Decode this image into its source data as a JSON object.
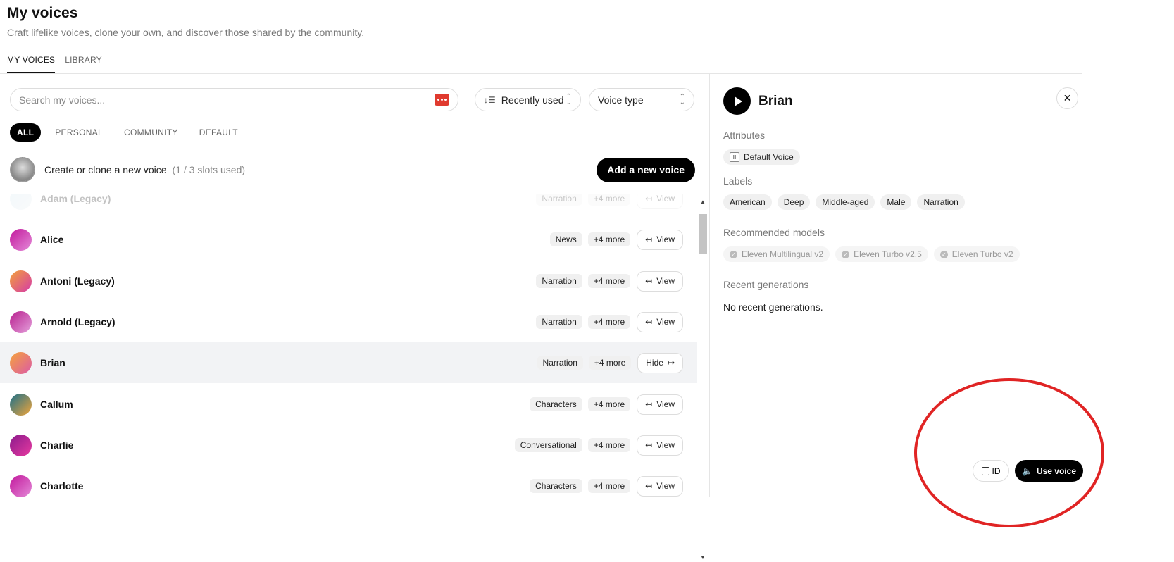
{
  "header": {
    "title": "My voices",
    "subtitle": "Craft lifelike voices, clone your own, and discover those shared by the community."
  },
  "tabs": [
    {
      "label": "MY VOICES",
      "active": true
    },
    {
      "label": "LIBRARY",
      "active": false
    }
  ],
  "search": {
    "placeholder": "Search my voices..."
  },
  "sort": {
    "label": "Recently used"
  },
  "voice_type": {
    "label": "Voice type"
  },
  "filters": [
    "ALL",
    "PERSONAL",
    "COMMUNITY",
    "DEFAULT"
  ],
  "create": {
    "text": "Create or clone a new voice",
    "slots": "(1 / 3 slots used)",
    "button": "Add a new voice"
  },
  "voices": [
    {
      "name": "Adam (Legacy)",
      "tag": "Narration",
      "more": "+4 more",
      "action": "View",
      "faded": true,
      "gradient": [
        "#cfe6f0",
        "#e8eef2"
      ]
    },
    {
      "name": "Alice",
      "tag": "News",
      "more": "+4 more",
      "action": "View",
      "gradient": [
        "#c2189c",
        "#e48ad8"
      ]
    },
    {
      "name": "Antoni (Legacy)",
      "tag": "Narration",
      "more": "+4 more",
      "action": "View",
      "gradient": [
        "#f2a13a",
        "#d63aa8"
      ]
    },
    {
      "name": "Arnold (Legacy)",
      "tag": "Narration",
      "more": "+4 more",
      "action": "View",
      "gradient": [
        "#b8208e",
        "#e4a0dc"
      ]
    },
    {
      "name": "Brian",
      "tag": "Narration",
      "more": "+4 more",
      "action": "Hide",
      "selected": true,
      "gradient": [
        "#f5a33c",
        "#dc5aa6"
      ]
    },
    {
      "name": "Callum",
      "tag": "Characters",
      "more": "+4 more",
      "action": "View",
      "gradient": [
        "#1a6f8a",
        "#f0a53a"
      ]
    },
    {
      "name": "Charlie",
      "tag": "Conversational",
      "more": "+4 more",
      "action": "View",
      "gradient": [
        "#8a1a8c",
        "#e83aa0"
      ]
    },
    {
      "name": "Charlotte",
      "tag": "Characters",
      "more": "+4 more",
      "action": "View",
      "gradient": [
        "#c2189c",
        "#e48ad8"
      ]
    }
  ],
  "detail": {
    "name": "Brian",
    "attributes_label": "Attributes",
    "attributes": [
      "Default Voice"
    ],
    "labels_label": "Labels",
    "labels": [
      "American",
      "Deep",
      "Middle-aged",
      "Male",
      "Narration"
    ],
    "models_label": "Recommended models",
    "models": [
      "Eleven Multilingual v2",
      "Eleven Turbo v2.5",
      "Eleven Turbo v2"
    ],
    "recent_label": "Recent generations",
    "recent_empty": "No recent generations.",
    "id_button": "ID",
    "use_button": "Use voice"
  },
  "colors": {
    "accent": "#000000",
    "annotation": "#e02424",
    "search_icon": "#e03a2f"
  }
}
